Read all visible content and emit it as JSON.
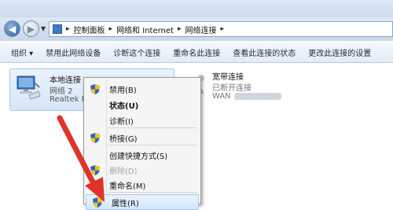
{
  "window": {
    "blurred_title": ""
  },
  "nav": {
    "back_glyph": "◀",
    "forward_glyph": "▶",
    "dropdown_glyph": "▼"
  },
  "address": {
    "icon": "network-folder-icon",
    "crumbs": [
      "控制面板",
      "网络和 Internet",
      "网络连接"
    ],
    "separator": "▸"
  },
  "toolbar": {
    "items": [
      "组织 ▾",
      "禁用此网络设备",
      "诊断这个连接",
      "重命名此连接",
      "查看此连接的状态",
      "更改此连接的设置"
    ]
  },
  "connections": {
    "local": {
      "name": "本地连接",
      "network": "网络  2",
      "adapter": "Realtek PC"
    },
    "broadband": {
      "name": "宽带连接",
      "status": "已断开连接",
      "type": "WAN"
    }
  },
  "context_menu": {
    "items": [
      {
        "label": "禁用(B)",
        "shield": true,
        "style": "normal"
      },
      {
        "label": "状态(U)",
        "shield": false,
        "style": "bold"
      },
      {
        "label": "诊断(I)",
        "shield": false,
        "style": "normal"
      },
      {
        "label": "桥接(G)",
        "shield": true,
        "style": "normal"
      },
      {
        "label": "创建快捷方式(S)",
        "shield": false,
        "style": "normal"
      },
      {
        "label": "删除(D)",
        "shield": true,
        "style": "disabled"
      },
      {
        "label": "重命名(M)",
        "shield": true,
        "style": "normal"
      },
      {
        "label": "属性(R)",
        "shield": true,
        "style": "hover"
      }
    ]
  },
  "colors": {
    "accent": "#3b7bc8",
    "arrow": "#e0342b",
    "shield_blue": "#2f64c4",
    "shield_yellow": "#f2c21b"
  }
}
